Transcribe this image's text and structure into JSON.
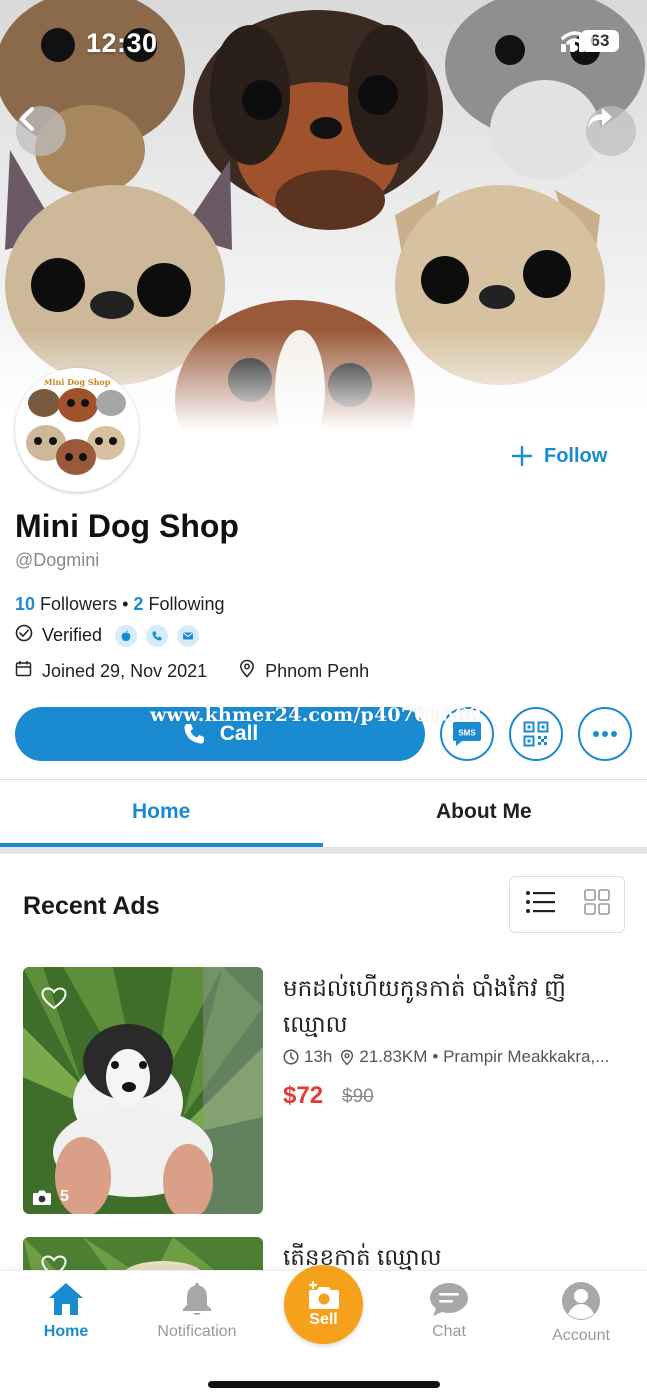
{
  "status_bar": {
    "time": "12:30",
    "battery": "63"
  },
  "profile": {
    "name": "Mini Dog Shop",
    "handle": "@Dogmini",
    "avatar_text": "Mini Dog Shop",
    "followers_count": "10",
    "followers_label": "Followers",
    "separator": "•",
    "following_count": "2",
    "following_label": "Following",
    "verified_label": "Verified",
    "joined": "Joined 29, Nov 2021",
    "location": "Phnom Penh"
  },
  "actions": {
    "follow_label": "Follow",
    "call_label": "Call",
    "watermark": "www.khmer24.com/p40701660",
    "sms_label": "SMS"
  },
  "tabs": [
    {
      "label": "Home",
      "active": true
    },
    {
      "label": "About Me",
      "active": false
    }
  ],
  "recent_ads": {
    "title": "Recent Ads",
    "items": [
      {
        "title": "មកដល់ហើយកូនកាត់ បាំងកែវ ញីឈ្មោល",
        "time": "13h",
        "distance": "21.83KM",
        "location": "• Prampir Meakkakra,...",
        "price": "$72",
        "old_price": "$90",
        "photo_count": "5"
      },
      {
        "title": "តើនខកាត់ ឈ្មោល"
      }
    ]
  },
  "bottom_nav": {
    "home": "Home",
    "notification": "Notification",
    "sell": "Sell",
    "chat": "Chat",
    "account": "Account"
  },
  "colors": {
    "accent": "#1a8bd0",
    "price": "#e53935",
    "sell": "#f5a11c"
  }
}
